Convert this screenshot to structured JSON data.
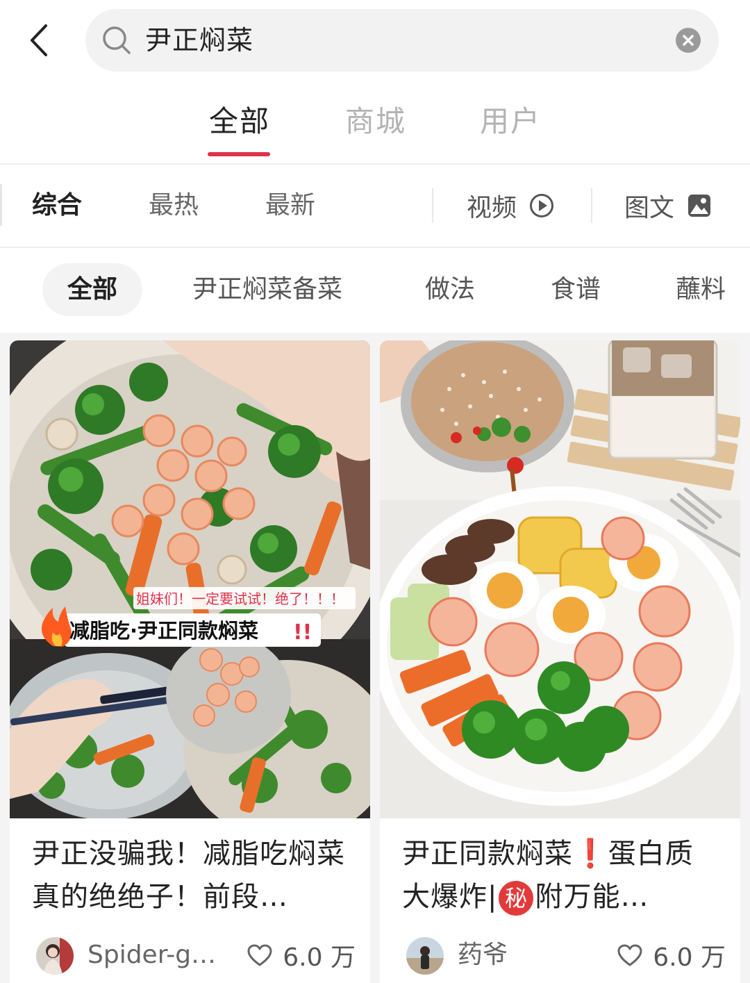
{
  "search": {
    "query": "尹正焖菜",
    "back_icon": "chevron-left-icon",
    "search_icon": "search-icon",
    "clear_icon": "clear-icon"
  },
  "primary_tabs": [
    {
      "label": "全部",
      "active": true
    },
    {
      "label": "商城",
      "active": false
    },
    {
      "label": "用户",
      "active": false
    }
  ],
  "sort_options": [
    {
      "label": "综合",
      "active": true
    },
    {
      "label": "最热",
      "active": false
    },
    {
      "label": "最新",
      "active": false
    }
  ],
  "format_filters": [
    {
      "label": "视频",
      "icon": "play-circle-icon"
    },
    {
      "label": "图文",
      "icon": "image-icon"
    }
  ],
  "filter_chips": [
    {
      "label": "全部",
      "active": true
    },
    {
      "label": "尹正焖菜备菜",
      "active": false
    },
    {
      "label": "做法",
      "active": false
    },
    {
      "label": "食谱",
      "active": false
    },
    {
      "label": "蘸料",
      "active": false
    }
  ],
  "cards": [
    {
      "title": "尹正没骗我！减脂吃焖菜真的绝绝子！前段…",
      "overlay_caption": "姐妹们！一定要试试！绝了！！！",
      "overlay_title": "减脂吃·尹正同款焖菜",
      "overlay_mark": "!!",
      "author": "Spider-g…",
      "likes": "6.0 万"
    },
    {
      "title_part1": "尹正同款焖菜",
      "title_mark": "❗",
      "title_part2": "蛋白质大爆炸|",
      "title_badge": "秘",
      "title_part3": "附万能…",
      "author": "药爷",
      "likes": "6.0 万"
    }
  ],
  "colors": {
    "accent": "#e0324a",
    "chip_bg": "#f3f3f3",
    "feed_bg": "#f4f4f4"
  }
}
